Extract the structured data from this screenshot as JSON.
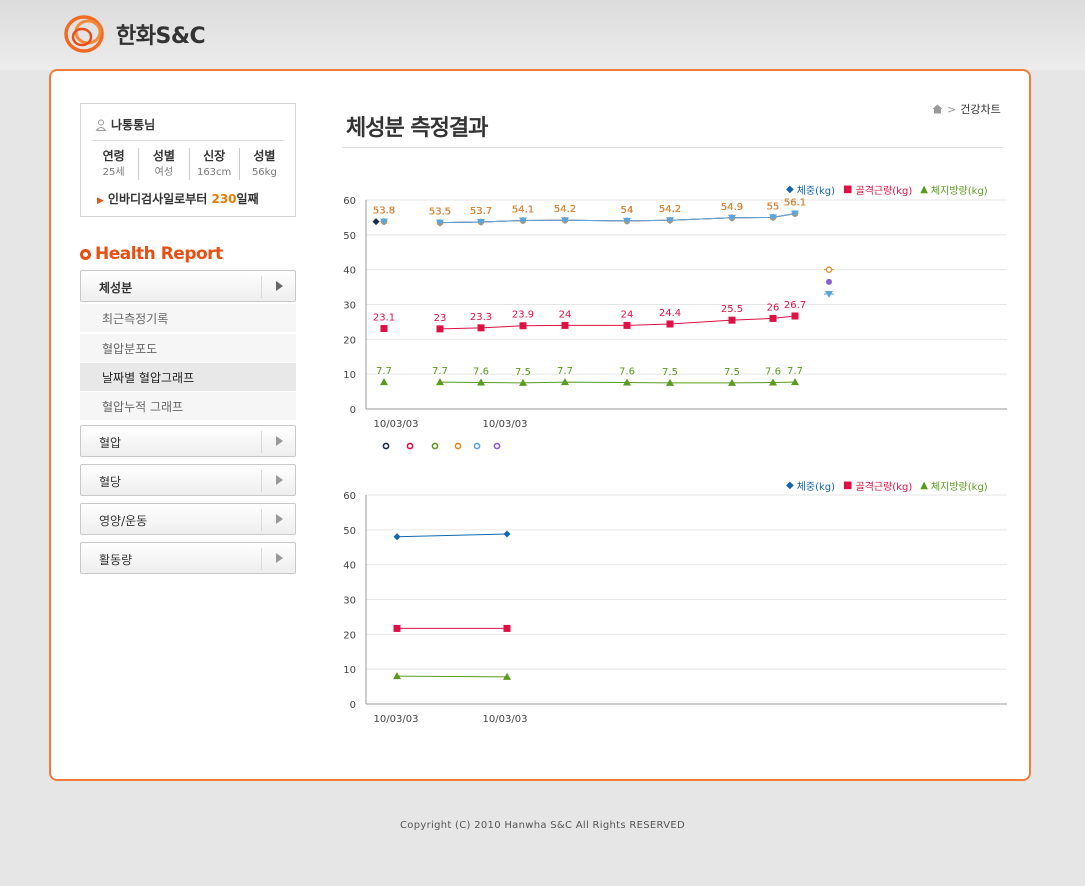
{
  "brand": {
    "name": "한화S&C"
  },
  "profile": {
    "name": "나통통님",
    "stats": [
      {
        "label": "연령",
        "value": "25세"
      },
      {
        "label": "성별",
        "value": "여성"
      },
      {
        "label": "신장",
        "value": "163cm"
      },
      {
        "label": "성별",
        "value": "56kg"
      }
    ],
    "since_prefix": "인바디검사일로부터 ",
    "since_days": "230",
    "since_suffix": "일째"
  },
  "sidebar": {
    "title": "Health Report",
    "active_menu": "체성분",
    "sub_items": [
      "최근측정기록",
      "혈압분포도",
      "날짜별 혈압그래프",
      "혈압누적 그래프"
    ],
    "selected_sub_index": 2,
    "menus": [
      "혈압",
      "혈당",
      "영양/운동",
      "활동량"
    ]
  },
  "breadcrumb": {
    "current": "건강차트"
  },
  "page_title": "체성분 측정결과",
  "legend": {
    "weight": "체중(kg)",
    "muscle": "골격근량(kg)",
    "fat": "체지방량(kg)"
  },
  "colors": {
    "accent": "#f07b3c",
    "weight": "#1466b0",
    "muscle": "#dd1144",
    "fat": "#5a9a1e",
    "purple": "#8b5fd1",
    "orange": "#e08a2c",
    "lightblue": "#5aa5dc"
  },
  "chart_data": [
    {
      "type": "line",
      "ylim": [
        0,
        60
      ],
      "yticks": [
        0,
        10,
        20,
        30,
        40,
        50,
        60
      ],
      "x_labels": [
        "10/03/03",
        "10/03/03"
      ],
      "series": [
        {
          "name": "체중(kg)",
          "color": "#1466b0",
          "marker": "diamond",
          "values": [
            53.8,
            53.5,
            53.7,
            54.1,
            54.2,
            54,
            54.2,
            54.9,
            55,
            56.1
          ],
          "labels": [
            "53.8",
            "53.5",
            "53.7",
            "54.1",
            "54.2",
            "54",
            "54.2",
            "54.9",
            "55",
            "56.1"
          ]
        },
        {
          "color": "#8b5fd1",
          "marker": "circle",
          "values": [
            53.8,
            53.5,
            53.7,
            54.1,
            54.2,
            54,
            54.2,
            54.9,
            55,
            56.1
          ],
          "labels": [
            "53.8",
            "53.5",
            "53.7",
            "54.1",
            "54.2",
            "54",
            "54.2",
            "54.9",
            "55",
            "56.1"
          ]
        },
        {
          "color": "#e08a2c",
          "marker": "ring",
          "values": [
            53.8,
            53.5,
            53.7,
            54.1,
            54.2,
            54,
            54.2,
            54.9,
            55,
            56.1
          ],
          "labels": [
            "53.8",
            "53.5",
            "53.7",
            "54.1",
            "54.2",
            "54",
            "54.2",
            "54.9",
            "55",
            "56.1"
          ]
        },
        {
          "name": "골격근량(kg)",
          "color": "#dd1144",
          "marker": "square",
          "values": [
            23.1,
            23,
            23.3,
            23.9,
            24,
            24,
            24.4,
            25.5,
            26,
            26.7
          ],
          "labels": [
            "23.1",
            "23",
            "23.3",
            "23.9",
            "24",
            "24",
            "24.4",
            "25.5",
            "26",
            "26.7"
          ]
        },
        {
          "color": "#5aa5dc",
          "marker": "tri-down",
          "label_color": "#e08a2c",
          "values": [
            53.8,
            53.5,
            53.7,
            54.1,
            54.2,
            54,
            54.2,
            54.9,
            55,
            56.1
          ],
          "labels": [
            "53.8",
            "53.5",
            "53.7",
            "54.1",
            "54.2",
            "54",
            "54.2",
            "54.9",
            "55",
            "56.1"
          ]
        },
        {
          "name": "체지방량(kg)",
          "color": "#5a9a1e",
          "marker": "tri-up",
          "values": [
            7.7,
            7.7,
            7.6,
            7.5,
            7.7,
            7.6,
            7.5,
            7.5,
            7.6,
            7.7
          ],
          "labels": [
            "7.7",
            "7.7",
            "7.6",
            "7.5",
            "7.7",
            "7.6",
            "7.5",
            "7.5",
            "7.6",
            "7.7"
          ]
        }
      ]
    },
    {
      "type": "line",
      "ylim": [
        0,
        60
      ],
      "yticks": [
        0,
        10,
        20,
        30,
        40,
        50,
        60
      ],
      "x": [
        "10/03/03",
        "10/03/03"
      ],
      "series": [
        {
          "name": "체중(kg)",
          "color": "#1466b0",
          "marker": "diamond",
          "values": [
            48,
            48.8
          ]
        },
        {
          "name": "골격근량(kg)",
          "color": "#dd1144",
          "marker": "square",
          "values": [
            21.7,
            21.7
          ]
        },
        {
          "name": "체지방량(kg)",
          "color": "#5a9a1e",
          "marker": "tri-up",
          "values": [
            8,
            7.8
          ]
        }
      ]
    }
  ],
  "footer": "Copyright (C) 2010 Hanwha S&C All Rights RESERVED"
}
